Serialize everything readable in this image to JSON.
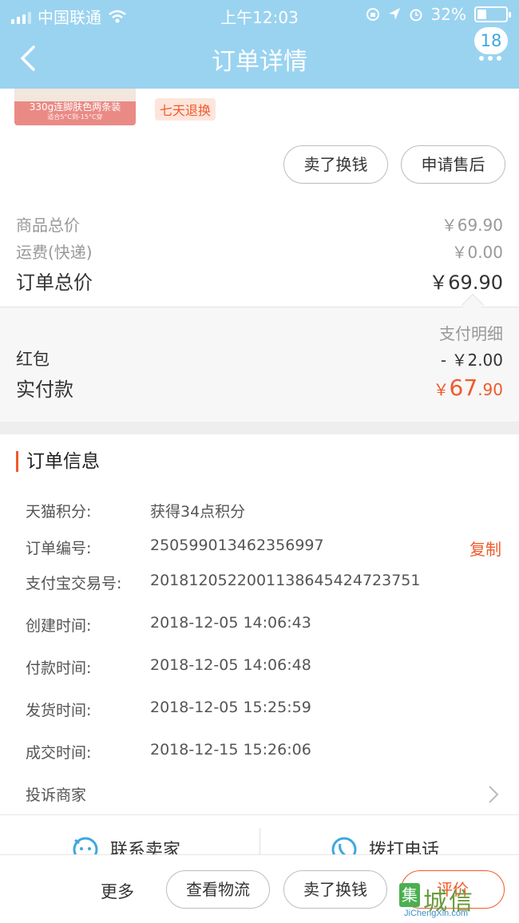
{
  "status_bar": {
    "carrier": "中国联通",
    "time": "上午12:03",
    "battery": "32%"
  },
  "nav": {
    "title": "订单详情",
    "badge": "18"
  },
  "product": {
    "thumb_label": "330g连脚肤色两条装",
    "thumb_sub": "适合5°C到-15°C穿",
    "return_tag": "七天退换"
  },
  "actions_top": {
    "sell_label": "卖了换钱",
    "after_sale_label": "申请售后"
  },
  "prices": {
    "goods_total_label": "商品总价",
    "goods_total_value": "￥69.90",
    "shipping_label": "运费(快递)",
    "shipping_value": "￥0.00",
    "order_total_label": "订单总价",
    "order_total_value": "￥69.90"
  },
  "payment": {
    "detail_label": "支付明细",
    "redpacket_label": "红包",
    "redpacket_value": "- ￥2.00",
    "paid_label": "实付款",
    "paid_currency": "￥",
    "paid_int": "67",
    "paid_dec": ".90"
  },
  "order_info": {
    "title": "订单信息",
    "rows": [
      {
        "label": "天猫积分:",
        "value": "获得34点积分"
      },
      {
        "label": "订单编号:",
        "value": "250599013462356997",
        "action": "复制"
      },
      {
        "label": "支付宝交易号:",
        "value": "2018120522001138645424723751"
      },
      {
        "label": "创建时间:",
        "value": "2018-12-05 14:06:43"
      },
      {
        "label": "付款时间:",
        "value": "2018-12-05 14:06:48"
      },
      {
        "label": "发货时间:",
        "value": "2018-12-05 15:25:59"
      },
      {
        "label": "成交时间:",
        "value": "2018-12-15 15:26:06"
      }
    ],
    "complain_label": "投诉商家"
  },
  "contact": {
    "seller_label": "联系卖家",
    "call_label": "拨打电话"
  },
  "bottom": {
    "more_label": "更多",
    "logistics_label": "查看物流",
    "sell_label": "卖了换钱",
    "rate_label": "评价"
  },
  "watermark": {
    "text": "城信",
    "url": "JiChengXin.com"
  },
  "colors": {
    "nav_bg": "#9ad3f0",
    "accent": "#f05a2a"
  }
}
